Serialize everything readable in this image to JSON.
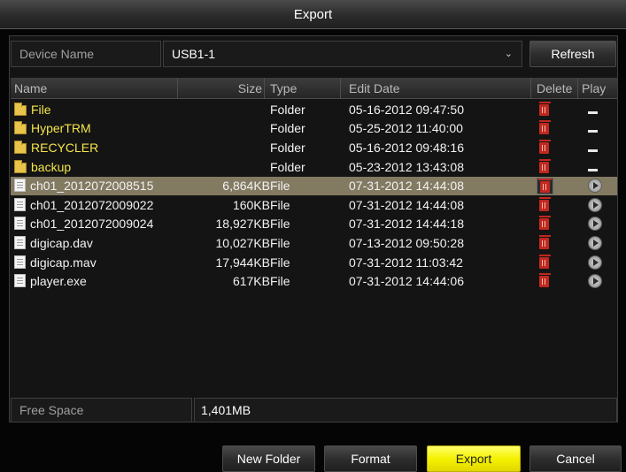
{
  "window": {
    "title": "Export"
  },
  "device": {
    "label": "Device Name",
    "value": "USB1-1",
    "refresh_label": "Refresh"
  },
  "table": {
    "headers": {
      "name": "Name",
      "size": "Size",
      "type": "Type",
      "edit_date": "Edit Date",
      "delete": "Delete",
      "play": "Play"
    },
    "rows": [
      {
        "name": "File",
        "size": "",
        "type": "Folder",
        "date": "05-16-2012 09:47:50"
      },
      {
        "name": "HyperTRM",
        "size": "",
        "type": "Folder",
        "date": "05-25-2012 11:40:00"
      },
      {
        "name": "RECYCLER",
        "size": "",
        "type": "Folder",
        "date": "05-16-2012 09:48:16"
      },
      {
        "name": "backup",
        "size": "",
        "type": "Folder",
        "date": "05-23-2012 13:43:08"
      },
      {
        "name": "ch01_2012072008515",
        "size": "6,864KB",
        "type": "File",
        "date": "07-31-2012 14:44:08"
      },
      {
        "name": "ch01_2012072009022",
        "size": "160KB",
        "type": "File",
        "date": "07-31-2012 14:44:08"
      },
      {
        "name": "ch01_2012072009024",
        "size": "18,927KB",
        "type": "File",
        "date": "07-31-2012 14:44:18"
      },
      {
        "name": "digicap.dav",
        "size": "10,027KB",
        "type": "File",
        "date": "07-13-2012 09:50:28"
      },
      {
        "name": "digicap.mav",
        "size": "17,944KB",
        "type": "File",
        "date": "07-31-2012 11:03:42"
      },
      {
        "name": "player.exe",
        "size": "617KB",
        "type": "File",
        "date": "07-31-2012 14:44:06"
      }
    ]
  },
  "free_space": {
    "label": "Free Space",
    "value": "1,401MB"
  },
  "buttons": {
    "new_folder": "New Folder",
    "format": "Format",
    "export": "Export",
    "cancel": "Cancel"
  },
  "colors": {
    "folder_text": "#f5e64a",
    "selected_row": "#837a62",
    "export_button": "#f5f200",
    "delete_icon": "#c2281e"
  }
}
